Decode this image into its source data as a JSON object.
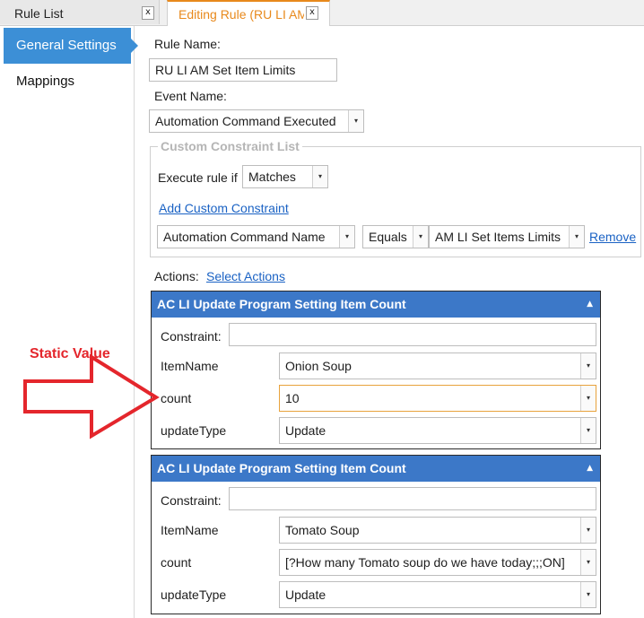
{
  "tabs": [
    {
      "label": "Rule List",
      "close": "x"
    },
    {
      "label": "Editing Rule (RU LI AM Set Item Limits)",
      "close": "x"
    }
  ],
  "nav": {
    "items": [
      {
        "label": "General Settings",
        "selected": true
      },
      {
        "label": "Mappings",
        "selected": false
      }
    ]
  },
  "form": {
    "rule_name_label": "Rule Name:",
    "rule_name_value": "RU LI AM Set Item Limits",
    "event_name_label": "Event Name:",
    "event_name_value": "Automation Command Executed"
  },
  "constraints": {
    "legend": "Custom Constraint List",
    "execute_label": "Execute rule if",
    "execute_value": "Matches",
    "add_link": "Add Custom Constraint",
    "row": {
      "field": "Automation Command Name",
      "operator": "Equals",
      "value": "AM LI Set Items Limits",
      "remove": "Remove"
    }
  },
  "actions": {
    "label": "Actions:",
    "select_link": "Select Actions",
    "panels": [
      {
        "title": "AC LI Update Program Setting Item Count",
        "constraint_label": "Constraint:",
        "constraint_value": "",
        "fields": [
          {
            "label": "ItemName",
            "value": "Onion Soup"
          },
          {
            "label": "count",
            "value": "10"
          },
          {
            "label": "updateType",
            "value": "Update"
          }
        ]
      },
      {
        "title": "AC LI Update Program Setting Item Count",
        "constraint_label": "Constraint:",
        "constraint_value": "",
        "fields": [
          {
            "label": "ItemName",
            "value": "Tomato Soup"
          },
          {
            "label": "count",
            "value": "[?How many Tomato soup do we have today;;;ON]"
          },
          {
            "label": "updateType",
            "value": "Update"
          }
        ]
      }
    ]
  },
  "annotation": {
    "text": "Static Value",
    "color": "#e4262c"
  },
  "icons": {
    "dropdown": "▾",
    "collapse": "▲"
  },
  "colors": {
    "accent": "#3c78c8",
    "nav_selected": "#3c8fd6",
    "active_tab": "#e8891c",
    "link": "#1a62c4"
  }
}
